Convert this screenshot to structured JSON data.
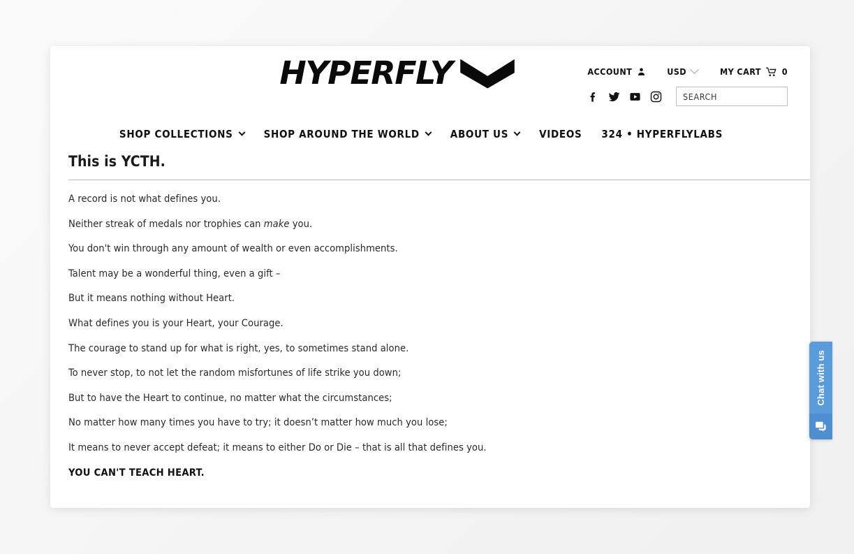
{
  "brand": {
    "logo_text": "HYPERFLY",
    "logo_mark": "chevron-down-mark"
  },
  "header": {
    "utility": {
      "account_label": "ACCOUNT",
      "account_icon": "user-icon",
      "currency_label": "USD",
      "currency_chevron_icon": "chevron-down-icon",
      "cart_label": "MY CART",
      "cart_icon": "shopping-cart-icon",
      "cart_count": "0"
    },
    "social": [
      {
        "name": "facebook-icon",
        "label": "Facebook"
      },
      {
        "name": "twitter-icon",
        "label": "Twitter"
      },
      {
        "name": "youtube-icon",
        "label": "YouTube"
      },
      {
        "name": "instagram-icon",
        "label": "Instagram"
      }
    ],
    "search": {
      "placeholder": "SEARCH",
      "value": ""
    }
  },
  "nav": {
    "items": [
      {
        "label": "SHOP COLLECTIONS",
        "has_dropdown": true
      },
      {
        "label": "SHOP AROUND THE WORLD",
        "has_dropdown": true
      },
      {
        "label": "ABOUT US",
        "has_dropdown": true
      },
      {
        "label": "VIDEOS",
        "has_dropdown": false
      },
      {
        "label": "324 • HYPERFLYLABS",
        "has_dropdown": false
      }
    ]
  },
  "article": {
    "title": "This is YCTH.",
    "paragraphs": [
      {
        "text": "A record is not what defines you.",
        "bold": false
      },
      {
        "text": "Neither streak of medals nor trophies can make you.",
        "bold": false,
        "italic_word": "make"
      },
      {
        "text": "You don't win through any amount of wealth or even accomplishments.",
        "bold": false
      },
      {
        "text": "Talent may be a wonderful thing, even a gift –",
        "bold": false
      },
      {
        "text": "But it means nothing without Heart.",
        "bold": false
      },
      {
        "text": "What defines you is your Heart, your Courage.",
        "bold": false
      },
      {
        "text": "The courage to stand up for what is right, yes, to sometimes stand alone.",
        "bold": false
      },
      {
        "text": "To never stop, to not let the random misfortunes of life strike you down;",
        "bold": false
      },
      {
        "text": "But to have the Heart to continue, no matter what the circumstances;",
        "bold": false
      },
      {
        "text": "No matter how many times you have to try; it doesn’t matter how much you lose;",
        "bold": false
      },
      {
        "text": "It means to never accept defeat; it means to either Do or Die – that is all that defines you.",
        "bold": false
      },
      {
        "text": "YOU CAN'T TEACH HEART.",
        "bold": true
      }
    ],
    "paragraph_pre": "Neither streak of medals nor trophies can ",
    "paragraph_em": "make",
    "paragraph_post": " you."
  },
  "chat_widget": {
    "label": "Chat with us",
    "icon": "chat-bubble-icon",
    "tab_color": "#5a9bdc",
    "foot_color": "#4e8ed2"
  },
  "colors": {
    "page_background": "#f4f4f4",
    "card_background": "#ffffff",
    "text": "#2a2a2a",
    "rule": "#b9b9b9"
  }
}
